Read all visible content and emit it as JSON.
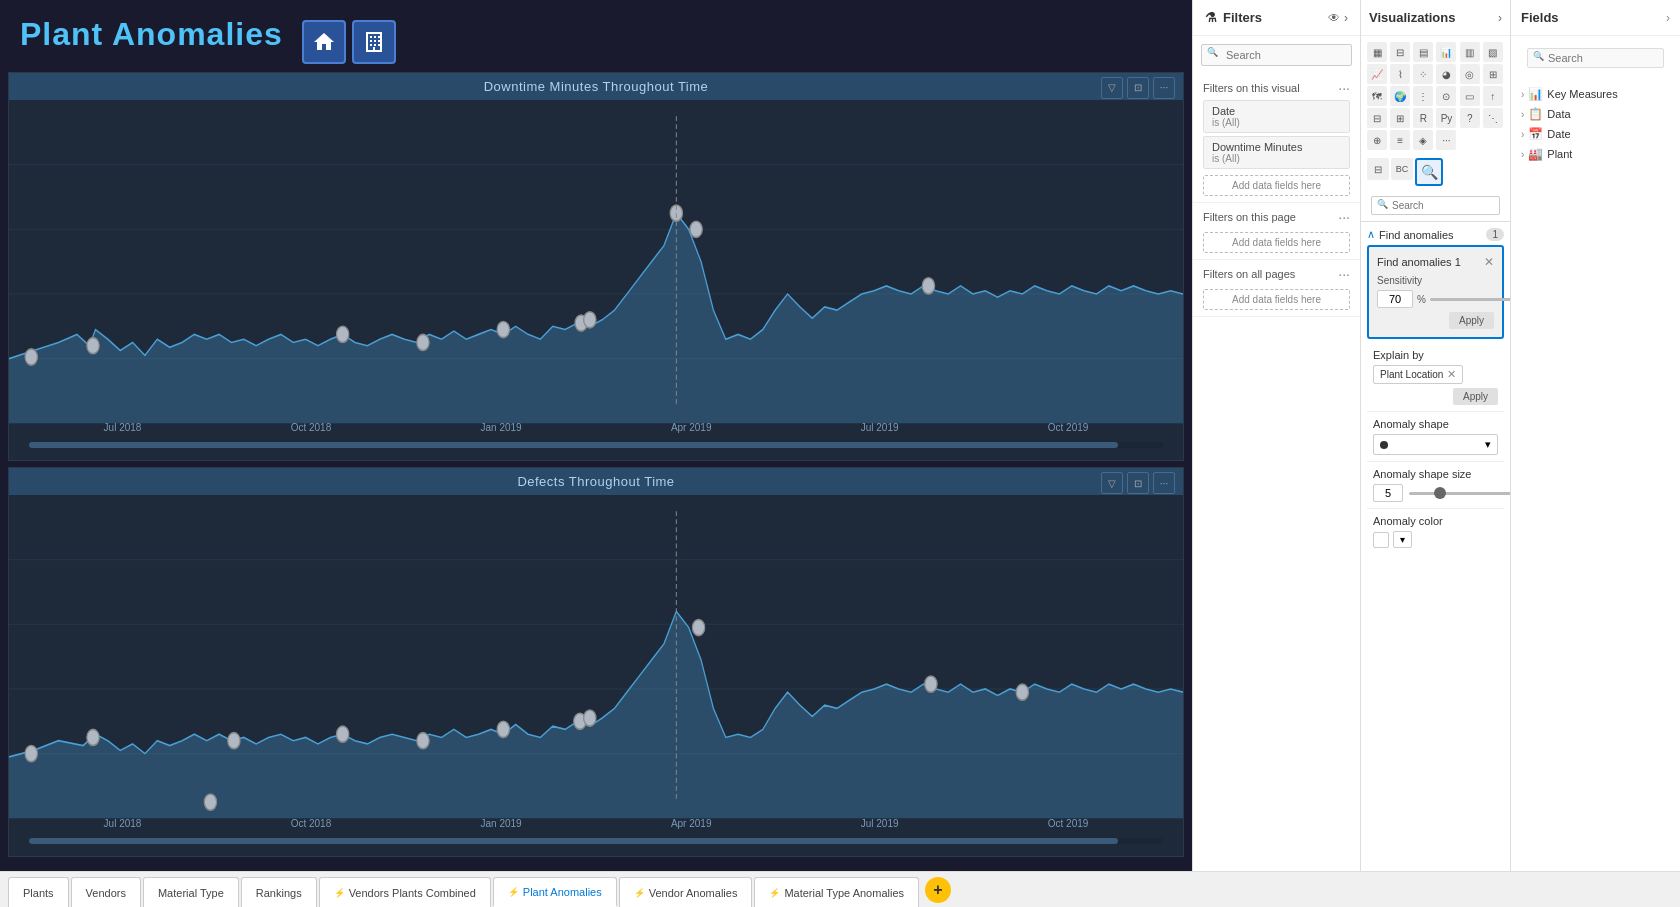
{
  "app": {
    "title": "Plant Anomalies"
  },
  "canvas": {
    "background": "#1a1a2e",
    "charts": [
      {
        "id": "chart-downtime",
        "title": "Downtime Minutes Throughout Time",
        "xLabels": [
          "Jul 2018",
          "Oct 2018",
          "Jan 2019",
          "Apr 2019",
          "Jul 2019",
          "Oct 2019"
        ]
      },
      {
        "id": "chart-defects",
        "title": "Defects Throughout Time",
        "xLabels": [
          "Jul 2018",
          "Oct 2018",
          "Jan 2019",
          "Apr 2019",
          "Jul 2019",
          "Oct 2019"
        ]
      }
    ]
  },
  "filters": {
    "panel_title": "Filters",
    "search_placeholder": "Search",
    "sections": [
      {
        "title": "Filters on this visual",
        "items": [
          {
            "name": "Date",
            "value": "is (All)"
          },
          {
            "name": "Downtime Minutes",
            "value": "is (All)"
          }
        ],
        "add_label": "Add data fields here"
      },
      {
        "title": "Filters on this page",
        "items": [],
        "add_label": "Add data fields here"
      },
      {
        "title": "Filters on all pages",
        "items": [],
        "add_label": "Add data fields here"
      }
    ]
  },
  "visualizations": {
    "panel_title": "Visualizations",
    "search_placeholder": "Search",
    "find_anomalies_label": "Find anomalies",
    "find_anomalies_count": "1",
    "anomaly_popup": {
      "title": "Find anomalies 1",
      "sensitivity_label": "Sensitivity",
      "sensitivity_value": "70",
      "sensitivity_unit": "%",
      "apply_label": "Apply"
    },
    "explain_by": {
      "label": "Explain by",
      "tag": "Plant Location",
      "apply_label": "Apply"
    },
    "anomaly_shape": {
      "label": "Anomaly shape",
      "value": "●",
      "dropdown_arrow": "▾"
    },
    "anomaly_shape_size": {
      "label": "Anomaly shape size",
      "value": "5"
    },
    "anomaly_color": {
      "label": "Anomaly color"
    }
  },
  "fields": {
    "panel_title": "Fields",
    "chevron": "›",
    "search_placeholder": "Search",
    "items": [
      {
        "label": "Key Measures",
        "icon": "📊",
        "expanded": true
      },
      {
        "label": "Data",
        "icon": "📋",
        "expanded": false
      },
      {
        "label": "Date",
        "icon": "📅",
        "expanded": false
      },
      {
        "label": "Plant",
        "icon": "🏭",
        "expanded": false
      }
    ]
  },
  "tabs": [
    {
      "label": "Plants",
      "active": false,
      "has_icon": false
    },
    {
      "label": "Vendors",
      "active": false,
      "has_icon": false
    },
    {
      "label": "Material Type",
      "active": false,
      "has_icon": false
    },
    {
      "label": "Rankings",
      "active": false,
      "has_icon": false
    },
    {
      "label": "Vendors Plants Combined",
      "active": false,
      "has_icon": true
    },
    {
      "label": "Plant Anomalies",
      "active": true,
      "has_icon": true
    },
    {
      "label": "Vendor Anomalies",
      "active": false,
      "has_icon": true
    },
    {
      "label": "Material Type Anomalies",
      "active": false,
      "has_icon": true
    }
  ],
  "add_tab_label": "+"
}
